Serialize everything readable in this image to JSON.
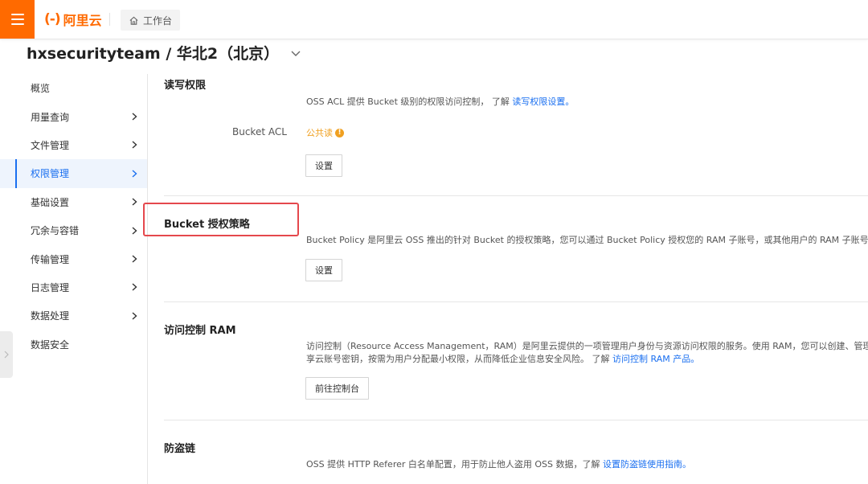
{
  "topbar": {
    "logo_mark": "(-)",
    "logo_text": "阿里云",
    "workbench_label": "工作台"
  },
  "page": {
    "title": "hxsecurityteam / 华北2（北京）"
  },
  "sidebar": {
    "items": [
      {
        "label": "概览",
        "has_arrow": false,
        "active": false
      },
      {
        "label": "用量查询",
        "has_arrow": true,
        "active": false
      },
      {
        "label": "文件管理",
        "has_arrow": true,
        "active": false
      },
      {
        "label": "权限管理",
        "has_arrow": true,
        "active": true
      },
      {
        "label": "基础设置",
        "has_arrow": true,
        "active": false
      },
      {
        "label": "冗余与容错",
        "has_arrow": true,
        "active": false
      },
      {
        "label": "传输管理",
        "has_arrow": true,
        "active": false
      },
      {
        "label": "日志管理",
        "has_arrow": true,
        "active": false
      },
      {
        "label": "数据处理",
        "has_arrow": true,
        "active": false
      },
      {
        "label": "数据安全",
        "has_arrow": false,
        "active": false
      }
    ]
  },
  "sections": {
    "rw_acl": {
      "title": "读写权限",
      "desc_prefix": "OSS ACL 提供 Bucket 级别的权限访问控制，  了解",
      "desc_link": "读写权限设置。",
      "acl_label": "Bucket ACL",
      "acl_value": "公共读",
      "acl_warn_glyph": "!",
      "button": "设置"
    },
    "bucket_policy": {
      "title": "Bucket 授权策略",
      "desc": "Bucket Policy 是阿里云 OSS 推出的针对 Bucket 的授权策略，您可以通过 Bucket Policy 授权您的 RAM 子账号，或其他用户的 RAM 子账号或者",
      "button": "设置"
    },
    "ram": {
      "title": "访问控制 RAM",
      "desc_line1": "访问控制（Resource Access Management，RAM）是阿里云提供的一项管理用户身份与资源访问权限的服务。使用 RAM，您可以创建、管理 RA",
      "desc_line2_prefix": "享云账号密钥，按需为用户分配最小权限，从而降低企业信息安全风险。  了解",
      "desc_line2_link": "访问控制 RAM 产品。",
      "button": "前往控制台"
    },
    "hotlink": {
      "title": "防盗链",
      "desc_prefix": "OSS 提供 HTTP Referer 白名单配置，用于防止他人盗用 OSS 数据，了解",
      "desc_link": "设置防盗链使用指南。"
    }
  },
  "colors": {
    "brand": "#ff6a00",
    "link": "#1a6ff0",
    "warning": "#f0a020",
    "highlight": "#e5484d"
  },
  "icons": {
    "menu": "hamburger-icon",
    "workbench": "home-icon",
    "title_dropdown": "chevron-down-icon",
    "nav_arrow": "chevron-right-icon",
    "edge_tab": "chevron-right-icon",
    "acl_warning": "warning-circle-icon"
  }
}
